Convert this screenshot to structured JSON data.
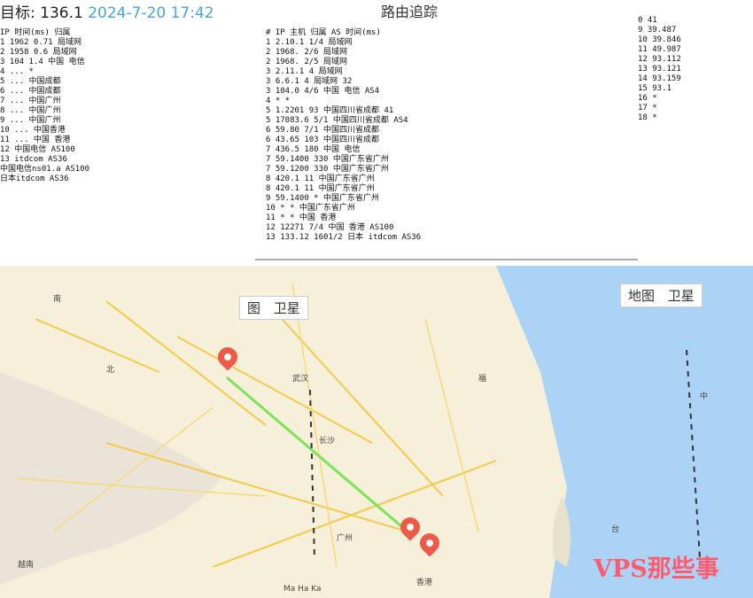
{
  "title": {
    "label": "目标: 136.1",
    "timestamp": "2024-7-20 17:42"
  },
  "hop_title": "路由追踪",
  "table": {
    "headers": [
      "#",
      "IP",
      "主机",
      "归属",
      "AS",
      "时间(ms)"
    ],
    "rows": [
      [
        "1",
        "2.10.1",
        "1/4",
        "局域网",
        "",
        ""
      ],
      [
        "2",
        "1968.",
        "2/6",
        "局域网",
        "",
        ""
      ],
      [
        "2",
        "1968.",
        "2/5",
        "局域网",
        "",
        ""
      ],
      [
        "3",
        "2.11.1",
        "4",
        "局域网",
        "",
        ""
      ],
      [
        "3",
        "6.6.1",
        "4",
        "局域网",
        "",
        "32"
      ],
      [
        "3",
        "104.0",
        "4/6",
        "中国 电信",
        "AS4",
        ""
      ],
      [
        "4",
        "*",
        "*",
        "",
        "",
        ""
      ],
      [
        "5",
        "1.2201",
        "93",
        "中国四川省成都",
        "",
        "41"
      ],
      [
        "5",
        "17083.6",
        "5/1",
        "中国四川省成都",
        "AS4",
        ""
      ],
      [
        "6",
        "59.80",
        "7/1",
        "中国四川省成都",
        "",
        ""
      ],
      [
        "6",
        "43.65",
        "103",
        "中国四川省成都",
        "",
        ""
      ],
      [
        "7",
        "436.5",
        "180",
        "中国 电信",
        "",
        ""
      ],
      [
        "7",
        "59.1400",
        "330",
        "中国广东省广州",
        "",
        ""
      ],
      [
        "7",
        "59.1200",
        "330",
        "中国广东省广州",
        "",
        ""
      ],
      [
        "8",
        "420.1",
        "11",
        "中国广东省广州",
        "",
        ""
      ],
      [
        "8",
        "420.1",
        "11",
        "中国广东省广州",
        "",
        ""
      ],
      [
        "9",
        "59.1400",
        "*",
        "中国广东省广州",
        "",
        ""
      ],
      [
        "10",
        "*",
        "*",
        "中国广东省广州",
        "",
        ""
      ],
      [
        "11",
        "*",
        "*",
        "中国 香港",
        "",
        ""
      ],
      [
        "12",
        "12271",
        "7/4",
        "中国 香港",
        "AS100",
        ""
      ],
      [
        "13",
        "133.12",
        "1601/2",
        "日本 itdcom",
        "AS36",
        ""
      ]
    ]
  },
  "left_rows": [
    "IP   时间(ms)  归属",
    "1  1962 0.71  局域网",
    "2  1958 0.6   局域网",
    "3  104 1.4   中国 电信",
    "4  ...  *",
    "5  ...  中国成都",
    "6  ...  中国成都",
    "7  ...  中国广州",
    "8  ...  中国广州",
    "9  ...  中国广州",
    "10 ...  中国香港",
    "11 ...  中国 香港",
    "12 中国电信 AS100",
    "13 itdcom AS36",
    "中国电信ns01.a  AS100",
    "日本itdcom      AS36"
  ],
  "right_rows": [
    "0   41",
    "9   39.487",
    "10  39.846",
    "11  49.987",
    "12  93.112",
    "13  93.121",
    "14  93.159",
    "15  93.1",
    "16  *",
    "17  *",
    "18  *"
  ],
  "map": {
    "btn_map": "地图",
    "btn_satellite": "卫星",
    "btn_left_top": "图",
    "btn_left_top2": "卫星",
    "labels": [
      "南",
      "北",
      "武汉",
      "长沙",
      "广州",
      "福",
      "台",
      "香港",
      "中",
      "越南",
      "Ma Ha Ka"
    ]
  },
  "watermark": "VPS那些事"
}
